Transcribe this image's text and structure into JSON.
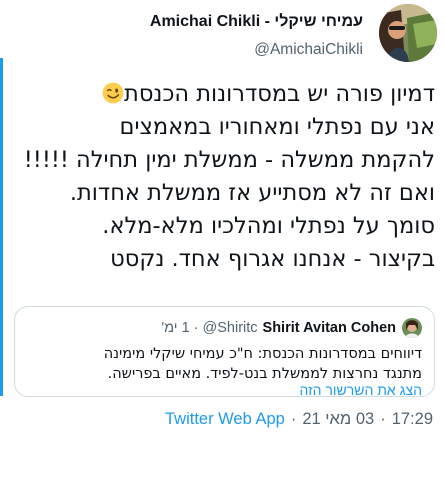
{
  "author": {
    "display_name": "עמיחי שיקלי - Amichai Chikli",
    "username": "@AmichaiChikli"
  },
  "tweet": {
    "lines": [
      "דמיון פורה יש במסדרונות הכנסת",
      "אני עם נפתלי ומאחוריו במאמצים",
      "להקמת ממשלה - ממשלת ימין תחילה !!!!!",
      "ואם זה לא מסתייע אז ממשלת אחדות.",
      "סומך על נפתלי ומהלכיו מלא-מלא.",
      "בקיצור - אנחנו אגרוף אחד. נקסט"
    ],
    "emoji": "winking-face-emoji"
  },
  "quoted_tweet": {
    "name": "Shirit Avitan Cohen",
    "handle": "@Shiritc",
    "separator": "·",
    "time": "1 ימ'",
    "lines": [
      "דיווחים במסדרונות הכנסת: ח\"כ עמיחי שיקלי מימינה",
      "מתנגד נחרצות לממשלת בנט-לפיד. מאיים בפרישה."
    ],
    "show_thread": "הצג את השרשור הזה"
  },
  "meta": {
    "time": "17:29",
    "sep1": "·",
    "date": "03 מאי 21",
    "sep2": "·",
    "app": "Twitter Web App"
  },
  "colors": {
    "accent": "#1d9bf0",
    "text": "#0f1419",
    "muted": "#536471",
    "border": "#cfd9de"
  }
}
